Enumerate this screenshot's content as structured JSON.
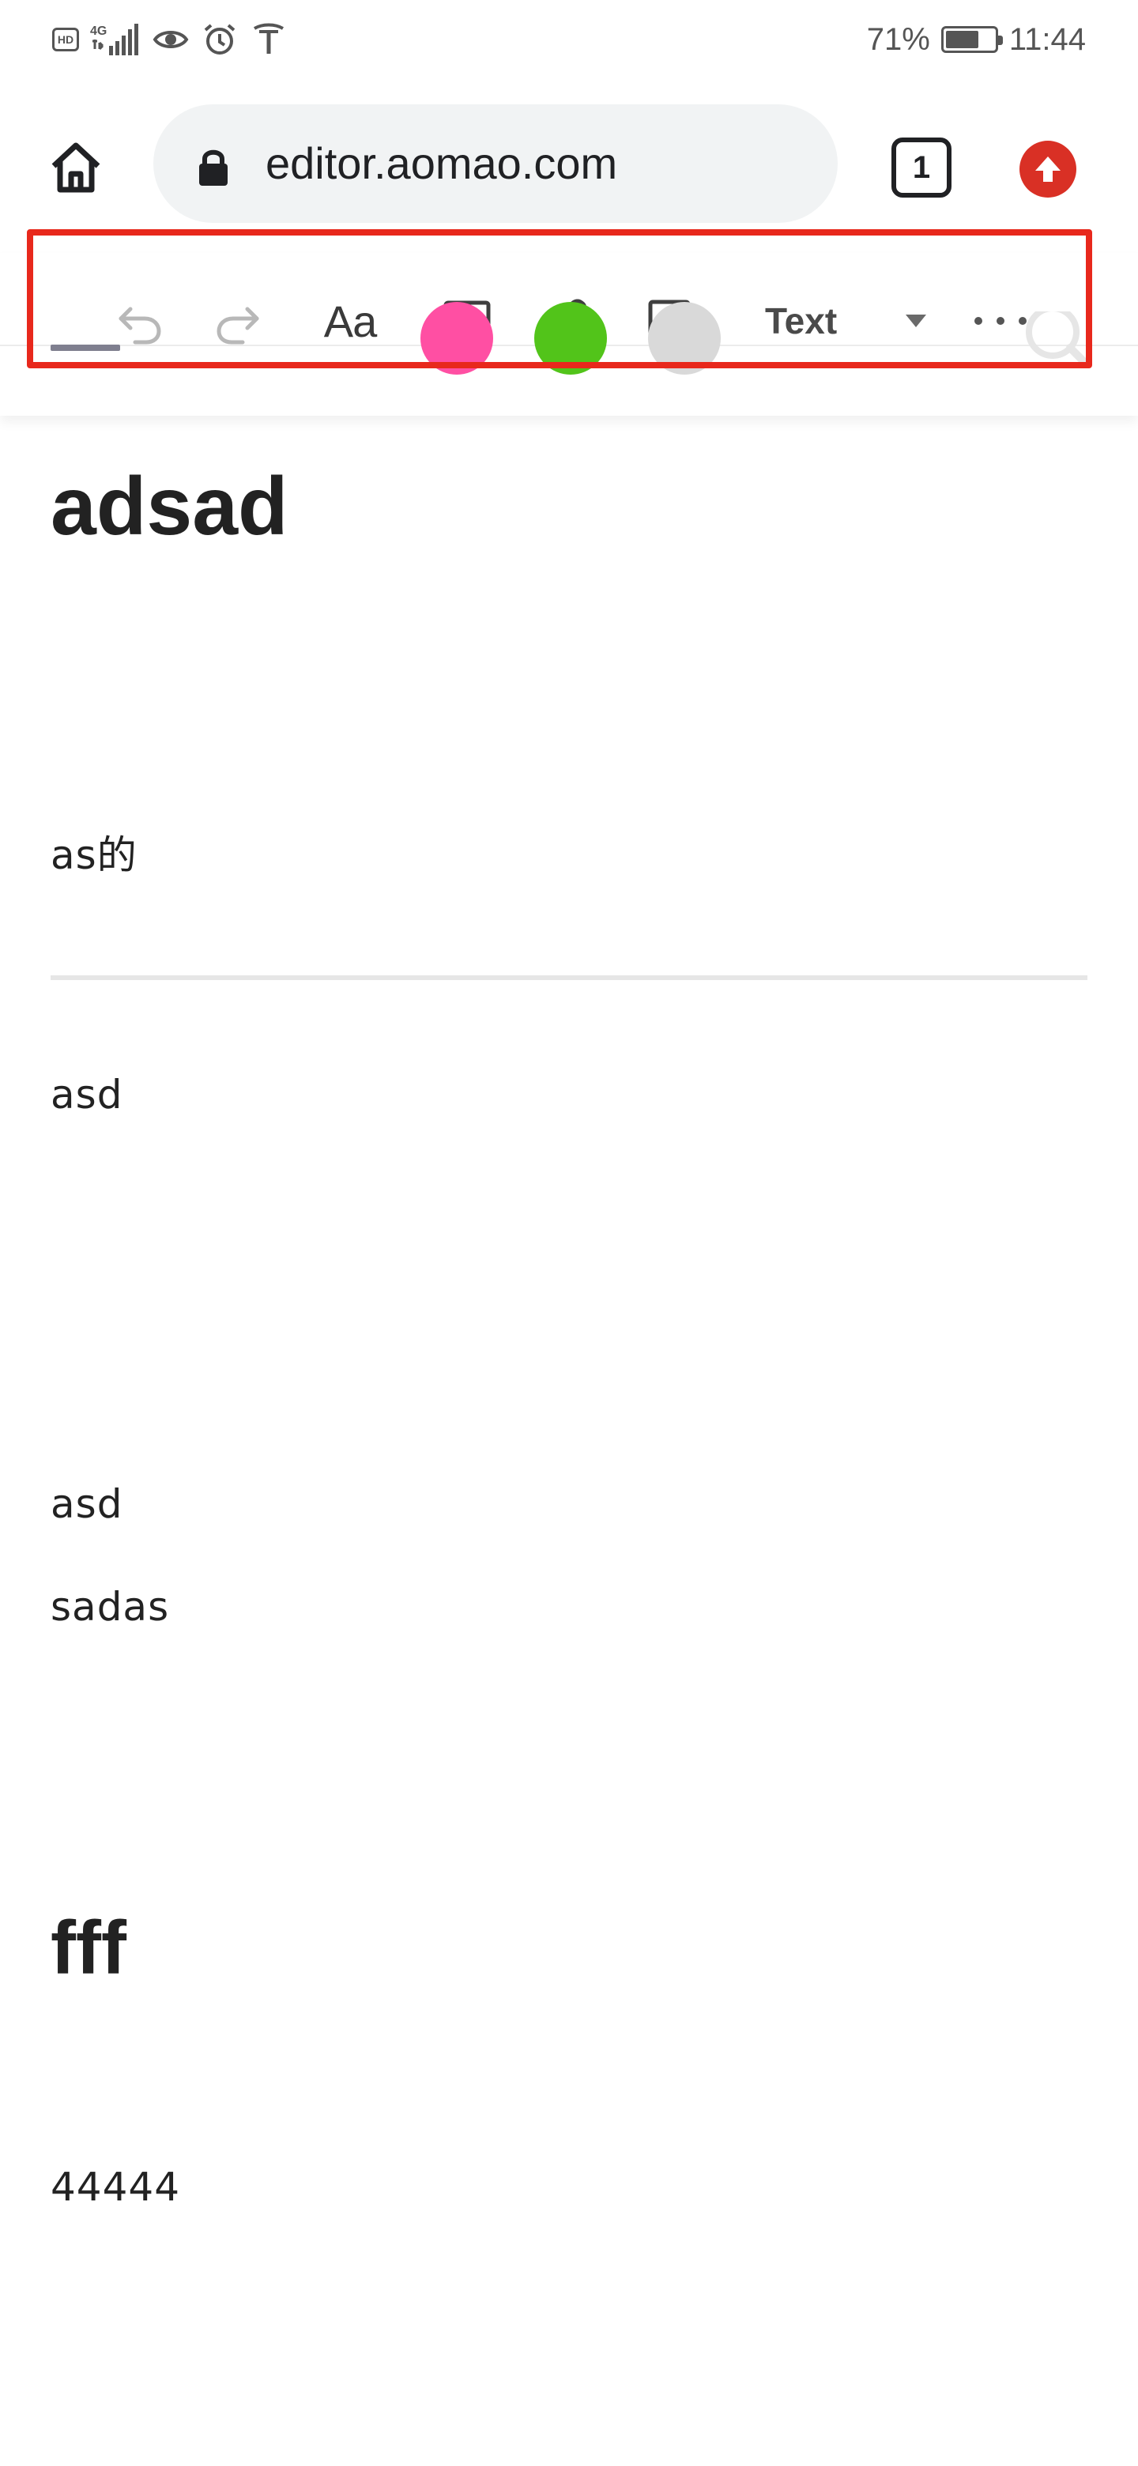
{
  "status_bar": {
    "left_icons": [
      "hd-icon",
      "signal-icon",
      "eye-icon",
      "alarm-icon",
      "tesla-icon"
    ],
    "hd_label": "HD",
    "network_label": "4G",
    "battery_percent": "71%",
    "battery_level": 0.71,
    "time": "11:44"
  },
  "browser": {
    "url": "editor.aomao.com",
    "tab_count": "1",
    "icons": {
      "home": "home-icon",
      "lock": "lock-icon",
      "update": "update-arrow-icon"
    },
    "colors": {
      "update": "#d93025",
      "pill": "#f1f3f4"
    }
  },
  "toolbar": {
    "icons": [
      "undo-icon",
      "redo-icon",
      "font-size-icon",
      "image-icon",
      "link-icon",
      "checkbox-icon",
      "dropdown-arrow-icon",
      "more-icon"
    ],
    "font_label": "Aa",
    "style_label": "Text",
    "swatch_colors": [
      "#ff4fa3",
      "#52c41a",
      "#d9d9d9"
    ],
    "highlight_color": "#e8281c"
  },
  "document": {
    "title": "adsad",
    "paragraph_1": "as的",
    "paragraph_2": "asd",
    "paragraph_3": "asd",
    "paragraph_4": "sadas",
    "heading_2": "fff",
    "paragraph_5": "44444"
  }
}
